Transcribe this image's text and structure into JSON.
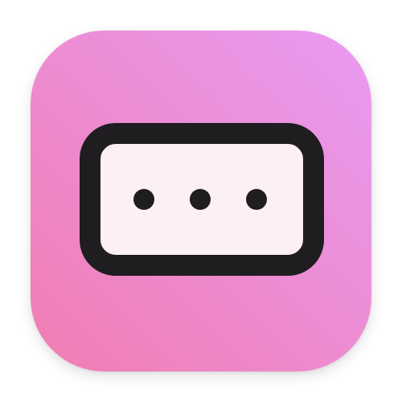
{
  "app_icon": {
    "icon_name": "password-field-icon",
    "colors": {
      "gradient_start": "#f07db2",
      "gradient_end": "#e99bf2",
      "frame": "#1f1d1f",
      "field_fill": "#fcf0f6",
      "dot": "#1f1d1f"
    },
    "masked_dots": 3
  }
}
